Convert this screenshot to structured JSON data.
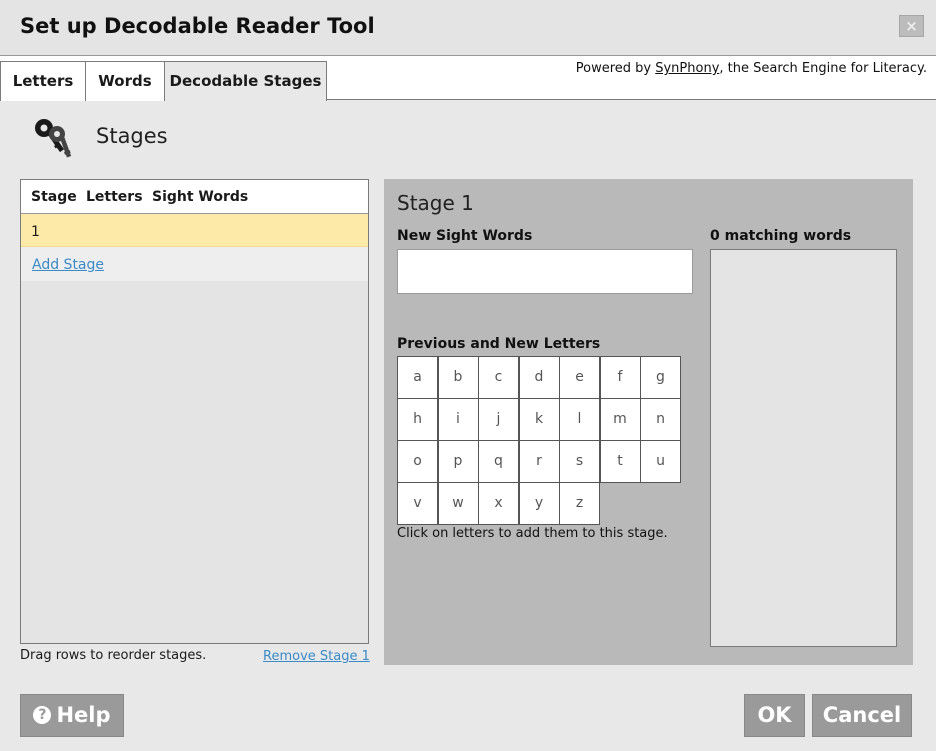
{
  "window": {
    "title": "Set up Decodable Reader Tool",
    "close_symbol": "×"
  },
  "tabs": [
    {
      "label": "Letters"
    },
    {
      "label": "Words"
    },
    {
      "label": "Decodable Stages",
      "active": true
    }
  ],
  "powered_by": {
    "prefix": "Powered by ",
    "link": "SynPhony",
    "suffix": ", the Search Engine for Literacy."
  },
  "section": {
    "title": "Stages",
    "icon": "keys-icon"
  },
  "stage_table": {
    "columns": [
      "Stage",
      "Letters",
      "Sight Words"
    ],
    "rows": [
      {
        "stage": "1",
        "letters": "",
        "sight_words": ""
      }
    ],
    "add_label": "Add Stage"
  },
  "footer_left": {
    "drag_hint": "Drag rows to reorder stages.",
    "remove_label": "Remove Stage 1"
  },
  "detail": {
    "title": "Stage 1",
    "sight_words_label": "New Sight Words",
    "sight_words_value": "",
    "matching_label": "0 matching words",
    "letters_label": "Previous and New Letters",
    "letters": [
      "a",
      "b",
      "c",
      "d",
      "e",
      "f",
      "g",
      "h",
      "i",
      "j",
      "k",
      "l",
      "m",
      "n",
      "o",
      "p",
      "q",
      "r",
      "s",
      "t",
      "u",
      "v",
      "w",
      "x",
      "y",
      "z"
    ],
    "click_hint": "Click on letters to add them to this stage."
  },
  "buttons": {
    "help": "Help",
    "help_icon": "question-circle-icon",
    "ok": "OK",
    "cancel": "Cancel"
  },
  "colors": {
    "selected_row": "#fdeaa8",
    "link": "#3a8ac8",
    "panel": "#b9b9b9",
    "button": "#9a9a9a"
  }
}
